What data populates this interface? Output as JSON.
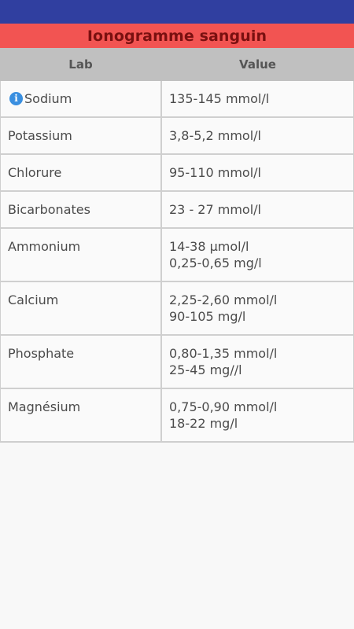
{
  "header": {
    "title": "Ionogramme sanguin"
  },
  "table": {
    "columns": {
      "lab": "Lab",
      "value": "Value"
    },
    "rows": [
      {
        "lab": "Sodium",
        "values": [
          "135-145 mmol/l"
        ],
        "has_info": true
      },
      {
        "lab": "Potassium",
        "values": [
          "3,8-5,2 mmol/l"
        ]
      },
      {
        "lab": "Chlorure",
        "values": [
          "95-110 mmol/l"
        ]
      },
      {
        "lab": "Bicarbonates",
        "values": [
          "23 - 27 mmol/l"
        ]
      },
      {
        "lab": "Ammonium",
        "values": [
          "14-38 µmol/l",
          "0,25-0,65 mg/l"
        ]
      },
      {
        "lab": "Calcium",
        "values": [
          "2,25-2,60 mmol/l",
          "90-105 mg/l"
        ]
      },
      {
        "lab": "Phosphate",
        "values": [
          "0,80-1,35 mmol/l",
          "25-45 mg//l"
        ]
      },
      {
        "lab": "Magnésium",
        "values": [
          "0,75-0,90 mmol/l",
          "18-22 mg/l"
        ]
      }
    ]
  },
  "icons": {
    "info": "info-icon"
  },
  "colors": {
    "status_bar": "#303fa0",
    "title_bar": "#f25452",
    "title_text": "#7a1010",
    "header_bg": "#c0c0c0",
    "info_icon": "#3a8fe0"
  }
}
